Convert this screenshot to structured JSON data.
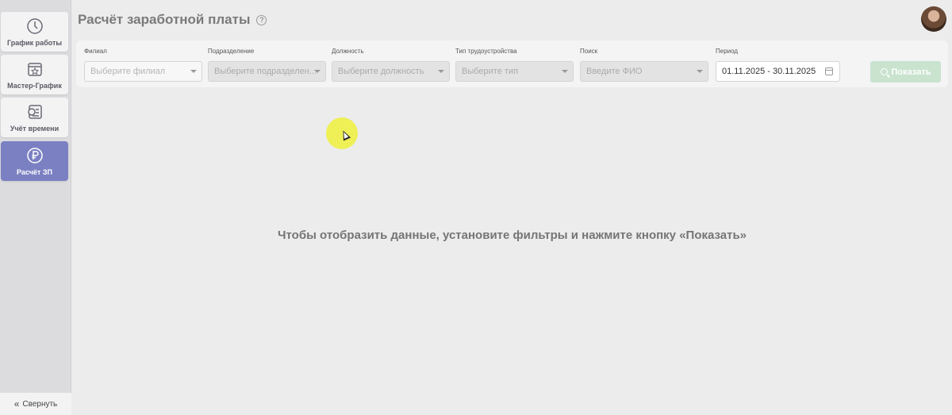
{
  "page": {
    "title": "Расчёт заработной платы",
    "help_icon": "question-circle-icon"
  },
  "sidebar": {
    "items": [
      {
        "label": "График работы",
        "icon": "clock-icon",
        "active": false
      },
      {
        "label": "Мастер-График",
        "icon": "calendar-star-icon",
        "active": false
      },
      {
        "label": "Учёт времени",
        "icon": "timesheet-icon",
        "active": false
      },
      {
        "label": "Расчёт ЗП",
        "icon": "ruble-icon",
        "active": true
      }
    ],
    "collapse_label": "Свернуть"
  },
  "filters": {
    "branch": {
      "label": "Филиал",
      "placeholder": "Выберите филиал"
    },
    "department": {
      "label": "Подразделение",
      "placeholder": "Выберите подразделен..."
    },
    "position": {
      "label": "Должность",
      "placeholder": "Выберите должность"
    },
    "employment_type": {
      "label": "Тип трудоустройства",
      "placeholder": "Выберите тип"
    },
    "search": {
      "label": "Поиск",
      "placeholder": "Введите ФИО"
    },
    "period": {
      "label": "Период",
      "value": "01.11.2025 - 30.11.2025"
    },
    "show_button": "Показать"
  },
  "empty_state": {
    "message": "Чтобы отобразить данные, установите фильтры и нажмите кнопку «Показать»"
  },
  "colors": {
    "accent": "#7b80c2",
    "button": "#c9e3cf",
    "background": "#ececec"
  }
}
